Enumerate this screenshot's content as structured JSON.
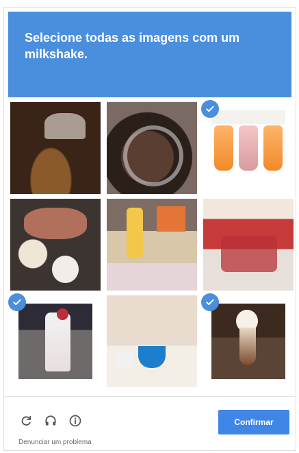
{
  "captcha": {
    "instruction": {
      "line1": "Selecione todas as imagens com um",
      "line2": "milkshake."
    },
    "tiles": [
      {
        "selected": false
      },
      {
        "selected": false
      },
      {
        "selected": true
      },
      {
        "selected": false
      },
      {
        "selected": false
      },
      {
        "selected": false
      },
      {
        "selected": true
      },
      {
        "selected": false
      },
      {
        "selected": true
      }
    ],
    "toolbar": {
      "reload_icon": "reload-icon",
      "audio_icon": "headphones-icon",
      "info_icon": "info-icon"
    },
    "confirm_label": "Confirmar",
    "report_label": "Denunciar um problema",
    "colors": {
      "header_bg": "#4a8fde",
      "check_bg": "#4a8fde",
      "button_bg": "#3f86e6"
    }
  }
}
